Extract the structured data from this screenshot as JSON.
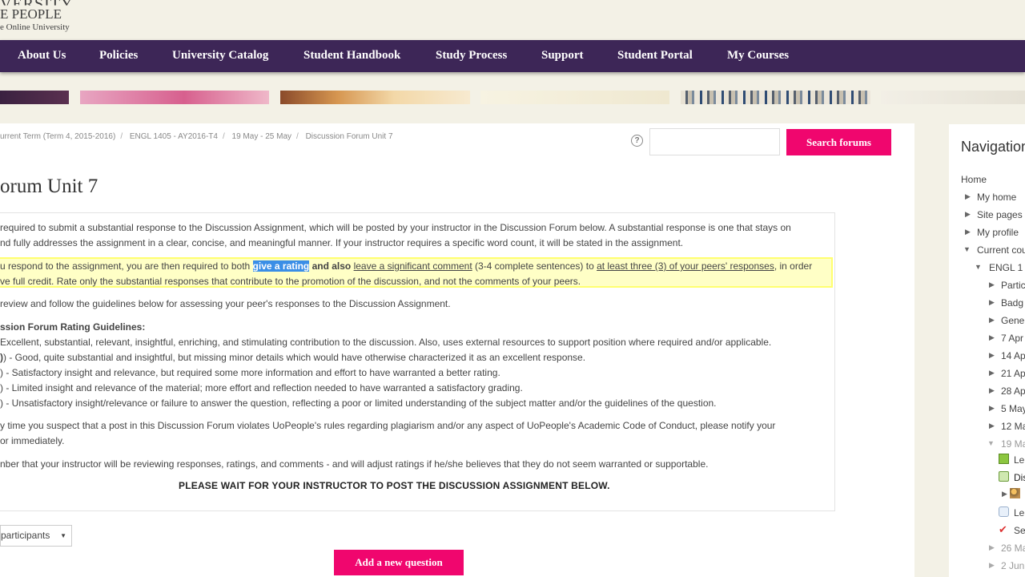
{
  "logo": {
    "line1": "VERSITY",
    "line2": "E PEOPLE",
    "line3": "e Online University"
  },
  "topnav": [
    "About Us",
    "Policies",
    "University Catalog",
    "Student Handbook",
    "Study Process",
    "Support",
    "Student Portal",
    "My Courses"
  ],
  "breadcrumb": [
    "urrent Term (Term 4, 2015-2016)",
    "ENGL 1405 - AY2016-T4",
    "19 May - 25 May",
    "Discussion Forum Unit 7"
  ],
  "search": {
    "button": "Search forums",
    "placeholder": ""
  },
  "page_title": "orum Unit 7",
  "content": {
    "p1a": " required to submit a substantial response to the Discussion Assignment, which will be posted by your instructor in the Discussion Forum below. A substantial response is one that stays on",
    "p1b": "nd fully addresses the assignment in a clear, concise, and meaningful manner. If your instructor requires a specific word count, it will be stated in the assignment.",
    "p2a_pre": "u respond to the assignment, you are then required to both ",
    "p2a_sel": "give a rating",
    "p2a_bold": " and also ",
    "p2a_link1": "leave a significant comment",
    "p2a_mid": " (3-4 complete sentences) to ",
    "p2a_link2": "at least three (3) of your peers' responses",
    "p2a_post": ", in order",
    "p2b": "ve full credit. Rate only the substantial responses that contribute to the promotion of the discussion, and not the comments of your peers.",
    "p3": "review and follow the guidelines below for assessing your peer's responses to the Discussion Assignment.",
    "guidelines_title": "ssion Forum Rating Guidelines:",
    "g1": " Excellent, substantial, relevant, insightful, enriching, and stimulating contribution to the discussion. Also, uses external resources to support position where required and/or applicable.",
    "g2": ") - Good, quite substantial and insightful, but missing minor details which would have otherwise characterized it as an excellent response.",
    "g3": ") - Satisfactory insight and relevance, but required some more information and effort to have warranted a better rating.",
    "g4": ") - Limited insight and relevance of the material; more effort and reflection needed to have warranted a satisfactory grading.",
    "g5": ") - Unsatisfactory insight/relevance or failure to answer the question, reflecting a poor or limited understanding of the subject matter and/or the guidelines of the question.",
    "p4a": "y time you suspect that a post in this Discussion Forum violates UoPeople's rules regarding plagiarism and/or any aspect of UoPeople's Academic Code of Conduct, please notify your",
    "p4b": "or immediately.",
    "p5": "nber that your instructor will be reviewing responses, ratings, and comments - and will adjust ratings if he/she believes that they do not seem warranted or supportable.",
    "wait": "PLEASE WAIT FOR YOUR INSTRUCTOR TO POST THE DISCUSSION ASSIGNMENT BELOW."
  },
  "participants_select": "participants",
  "add_button": "Add a new question",
  "navigation": {
    "title": "Navigation",
    "home": "Home",
    "my_home": "My home",
    "site_pages": "Site pages",
    "my_profile": "My profile",
    "current_courses": "Current cou",
    "course": "ENGL 1",
    "sections": [
      "Partic",
      "Badg",
      "Gene",
      "7 Apr",
      "14 Ap",
      "21 Ap",
      "28 Ap",
      "5 May",
      "12 Ma",
      "19 Ma"
    ],
    "activities": [
      "Le",
      "Dis",
      "",
      "Le",
      "Se"
    ],
    "later": [
      "26 Ma",
      "2 Jun"
    ]
  }
}
